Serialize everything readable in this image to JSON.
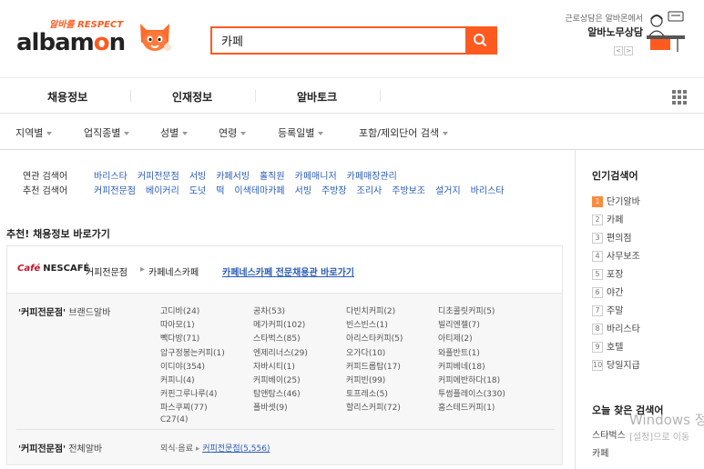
{
  "header": {
    "logo_tagline": "알바를 RESPECT",
    "logo_text_part1": "albam",
    "logo_text_part2": "o",
    "logo_text_part3": "n",
    "search_value": "카페",
    "labor_sub": "근로상담은 알바몬에서",
    "labor_title": "알바노무상담",
    "prev_arrow": "<",
    "next_arrow": ">"
  },
  "gnb": {
    "items": [
      "채용정보",
      "인재정보",
      "알바토크"
    ]
  },
  "filters": {
    "items": [
      "지역별",
      "업직종별",
      "성별",
      "연령",
      "등록일별",
      "포함/제외단어 검색"
    ]
  },
  "keywords": {
    "related_label": "연관 검색어",
    "related": [
      "바리스타",
      "커피전문점",
      "서빙",
      "카페서빙",
      "홀직원",
      "카페매니저",
      "카페매장관리"
    ],
    "recommended_label": "추천 검색어",
    "recommended": [
      "커피전문점",
      "베이커리",
      "도넛",
      "떡",
      "이색테마카페",
      "서빙",
      "주방장",
      "조리사",
      "주방보조",
      "설거지",
      "바리스타"
    ]
  },
  "shortcut": {
    "title": "추천! 채용정보 바로가기",
    "brand_logo_cafe": "Café",
    "brand_logo_name": "NESCAFÉ",
    "crumb1": "커피전문점",
    "crumb2": "카페네스카페",
    "link": "카페네스카페 전문채용관 바로가기"
  },
  "brand_table": {
    "brand_label_quote": "'커피전문점'",
    "brand_label_suffix": "브랜드알바",
    "brands": [
      [
        "고디바(24)",
        "공차(53)",
        "다빈치커피(2)",
        "디초콜릿커피(5)"
      ],
      [
        "따아모(1)",
        "메가커피(102)",
        "빈스빈스(1)",
        "빌리엔젤(7)"
      ],
      [
        "빽다방(71)",
        "스타벅스(85)",
        "아리스타커피(5)",
        "아티제(2)"
      ],
      [
        "압구정봉는커피(1)",
        "엔제리너스(29)",
        "오가다(10)",
        "와플반트(1)"
      ],
      [
        "이디야(354)",
        "자바시티(1)",
        "커피드롭탑(17)",
        "커피베네(18)"
      ],
      [
        "커피니(4)",
        "커피베이(25)",
        "커피빈(99)",
        "커피에반하다(18)"
      ],
      [
        "커핀그루나루(4)",
        "탐앤탐스(46)",
        "토프레소(5)",
        "투썸플레이스(330)"
      ],
      [
        "파스쿠찌(77)",
        "폴바셋(9)",
        "할리스커피(72)",
        "홈스테드커피(1)"
      ],
      [
        "C27(4)"
      ]
    ],
    "total_label_quote": "'커피전문점'",
    "total_label_suffix": "전체알바",
    "total_prefix": "외식·음료",
    "total_link": "커피전문점(5,556)"
  },
  "right_panel": {
    "popular_title": "인기검색어",
    "popular": [
      "단기알바",
      "카페",
      "편의점",
      "사무보조",
      "포장",
      "야간",
      "주말",
      "바리스타",
      "호텔",
      "당일지급"
    ],
    "today_title": "오늘 찾은 검색어",
    "today": [
      "스타벅스",
      "카페"
    ]
  },
  "watermark": {
    "line1": "Windows 정",
    "line2": "[설정]으로 이동"
  },
  "colors": {
    "brand_orange": "#ff5a1f",
    "link_blue": "#2a5cb8"
  }
}
